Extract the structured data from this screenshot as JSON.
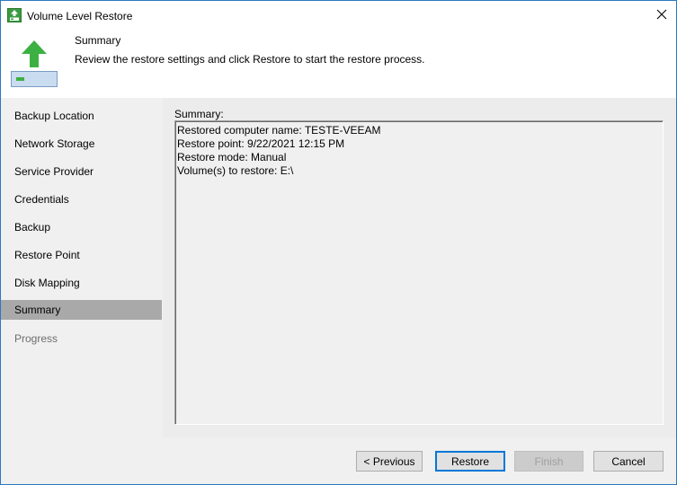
{
  "window": {
    "title": "Volume Level Restore",
    "title_icon": "veeam-restore-icon",
    "close_icon": "close-icon"
  },
  "header": {
    "icon": "green-up-arrow-restore-icon",
    "title": "Summary",
    "description": "Review the restore settings and click Restore to start the restore process."
  },
  "sidebar": {
    "items": [
      {
        "label": "Backup Location",
        "state": "normal"
      },
      {
        "label": "Network Storage",
        "state": "normal"
      },
      {
        "label": "Service Provider",
        "state": "normal"
      },
      {
        "label": "Credentials",
        "state": "normal"
      },
      {
        "label": "Backup",
        "state": "normal"
      },
      {
        "label": "Restore Point",
        "state": "normal"
      },
      {
        "label": "Disk Mapping",
        "state": "normal"
      },
      {
        "label": "Summary",
        "state": "active"
      },
      {
        "label": "Progress",
        "state": "disabled"
      }
    ]
  },
  "main": {
    "summary_label": "Summary:",
    "summary_lines": [
      "Restored computer name: TESTE-VEEAM",
      "Restore point: 9/22/2021 12:15 PM",
      "Restore mode: Manual",
      "Volume(s) to restore: E:\\"
    ]
  },
  "footer": {
    "previous_label": "< Previous",
    "restore_label": "Restore",
    "finish_label": "Finish",
    "cancel_label": "Cancel"
  },
  "colors": {
    "active_nav": "#a9a9a9",
    "accent_green": "#3cb043",
    "focus_blue": "#0078d7"
  }
}
